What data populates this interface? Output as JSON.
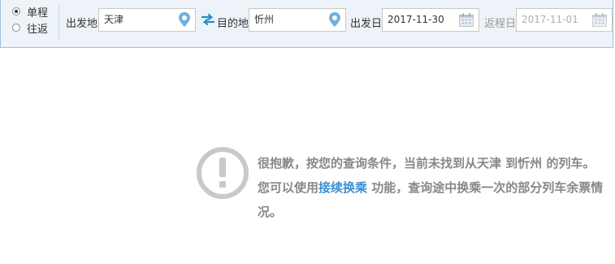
{
  "trip_type": {
    "options": [
      "单程",
      "往返"
    ],
    "selected": "单程"
  },
  "from": {
    "label": "出发地",
    "value": "天津"
  },
  "to": {
    "label": "目的地",
    "value": "忻州"
  },
  "depart_date": {
    "label": "出发日",
    "value": "2017-11-30"
  },
  "return_date": {
    "label": "返程日",
    "value": "2017-11-01"
  },
  "notice": {
    "part1": "很抱歉，按您的查询条件，当前未找到从天津 到忻州 的列车。您可以使用",
    "link": "接续换乘",
    "part2": " 功能，查询途中换乘一次的部分列车余票情况。"
  },
  "colors": {
    "bar_bg": "#eef3f9",
    "accent": "#3d8fd1",
    "swap": "#1f8fc9",
    "pin": "#5fa2d6",
    "muted_text": "#888888"
  },
  "icons": [
    "radio",
    "location-pin-icon",
    "swap-icon",
    "calendar-icon",
    "exclamation-icon"
  ]
}
